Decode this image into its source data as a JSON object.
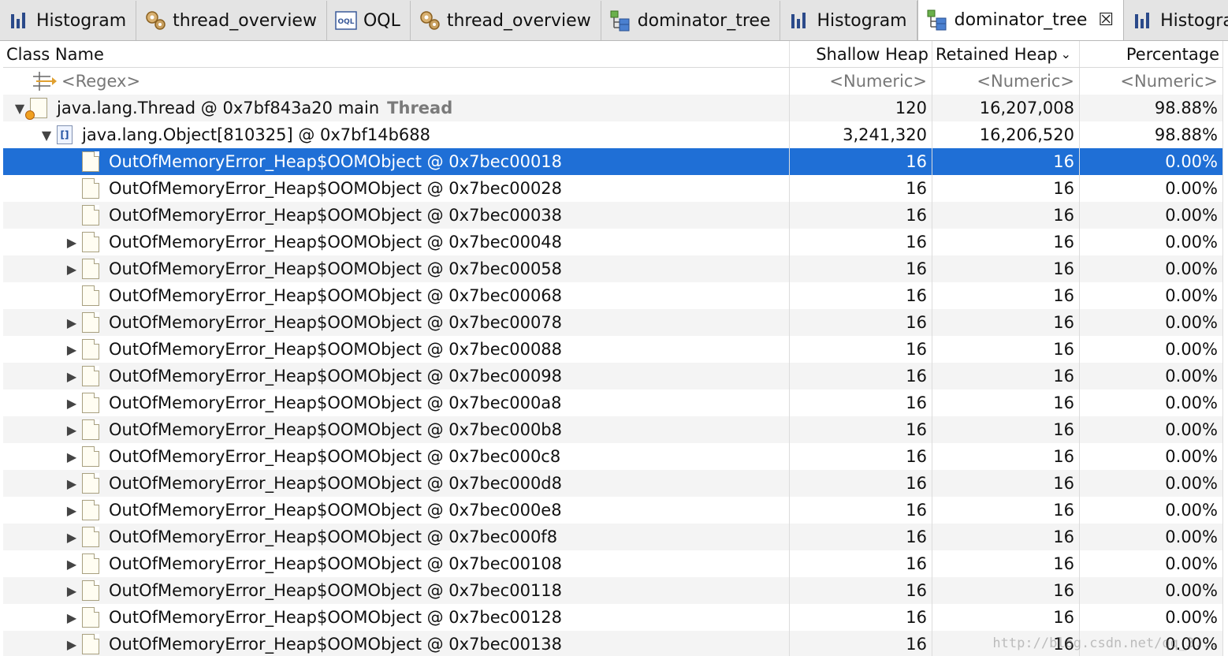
{
  "tabs": [
    {
      "label": "Histogram",
      "icon": "histogram-icon",
      "active": false
    },
    {
      "label": "thread_overview",
      "icon": "gears-icon",
      "active": false
    },
    {
      "label": "OQL",
      "icon": "oql-icon",
      "active": false
    },
    {
      "label": "thread_overview",
      "icon": "gears-icon",
      "active": false
    },
    {
      "label": "dominator_tree",
      "icon": "dominator-tree-icon",
      "active": false
    },
    {
      "label": "Histogram",
      "icon": "histogram-icon",
      "active": false
    },
    {
      "label": "dominator_tree",
      "icon": "dominator-tree-icon",
      "active": true
    },
    {
      "label": "Histogram",
      "icon": "histogram-icon",
      "active": false
    }
  ],
  "tab_overflow": "»",
  "table": {
    "headers": {
      "class_name": "Class Name",
      "shallow_heap": "Shallow Heap",
      "retained_heap": "Retained Heap",
      "percentage": "Percentage"
    },
    "sort_indicator": "⌄",
    "filter_row": {
      "name": "<Regex>",
      "shallow": "<Numeric>",
      "retained": "<Numeric>",
      "percentage": "<Numeric>"
    },
    "thread_row": {
      "name": "java.lang.Thread @ 0x7bf843a20  main",
      "thread_label": "Thread",
      "shallow": "120",
      "retained": "16,207,008",
      "percentage": "98.88%"
    },
    "array_row": {
      "name": "java.lang.Object[810325] @ 0x7bf14b688",
      "shallow": "3,241,320",
      "retained": "16,206,520",
      "percentage": "98.88%"
    },
    "object_rows": [
      {
        "name": "OutOfMemoryError_Heap$OOMObject @ 0x7bec00018",
        "shallow": "16",
        "retained": "16",
        "percentage": "0.00%",
        "expandable": false,
        "selected": true
      },
      {
        "name": "OutOfMemoryError_Heap$OOMObject @ 0x7bec00028",
        "shallow": "16",
        "retained": "16",
        "percentage": "0.00%",
        "expandable": false,
        "selected": false
      },
      {
        "name": "OutOfMemoryError_Heap$OOMObject @ 0x7bec00038",
        "shallow": "16",
        "retained": "16",
        "percentage": "0.00%",
        "expandable": false,
        "selected": false
      },
      {
        "name": "OutOfMemoryError_Heap$OOMObject @ 0x7bec00048",
        "shallow": "16",
        "retained": "16",
        "percentage": "0.00%",
        "expandable": true,
        "selected": false
      },
      {
        "name": "OutOfMemoryError_Heap$OOMObject @ 0x7bec00058",
        "shallow": "16",
        "retained": "16",
        "percentage": "0.00%",
        "expandable": true,
        "selected": false
      },
      {
        "name": "OutOfMemoryError_Heap$OOMObject @ 0x7bec00068",
        "shallow": "16",
        "retained": "16",
        "percentage": "0.00%",
        "expandable": false,
        "selected": false
      },
      {
        "name": "OutOfMemoryError_Heap$OOMObject @ 0x7bec00078",
        "shallow": "16",
        "retained": "16",
        "percentage": "0.00%",
        "expandable": true,
        "selected": false
      },
      {
        "name": "OutOfMemoryError_Heap$OOMObject @ 0x7bec00088",
        "shallow": "16",
        "retained": "16",
        "percentage": "0.00%",
        "expandable": true,
        "selected": false
      },
      {
        "name": "OutOfMemoryError_Heap$OOMObject @ 0x7bec00098",
        "shallow": "16",
        "retained": "16",
        "percentage": "0.00%",
        "expandable": true,
        "selected": false
      },
      {
        "name": "OutOfMemoryError_Heap$OOMObject @ 0x7bec000a8",
        "shallow": "16",
        "retained": "16",
        "percentage": "0.00%",
        "expandable": true,
        "selected": false
      },
      {
        "name": "OutOfMemoryError_Heap$OOMObject @ 0x7bec000b8",
        "shallow": "16",
        "retained": "16",
        "percentage": "0.00%",
        "expandable": true,
        "selected": false
      },
      {
        "name": "OutOfMemoryError_Heap$OOMObject @ 0x7bec000c8",
        "shallow": "16",
        "retained": "16",
        "percentage": "0.00%",
        "expandable": true,
        "selected": false
      },
      {
        "name": "OutOfMemoryError_Heap$OOMObject @ 0x7bec000d8",
        "shallow": "16",
        "retained": "16",
        "percentage": "0.00%",
        "expandable": true,
        "selected": false
      },
      {
        "name": "OutOfMemoryError_Heap$OOMObject @ 0x7bec000e8",
        "shallow": "16",
        "retained": "16",
        "percentage": "0.00%",
        "expandable": true,
        "selected": false
      },
      {
        "name": "OutOfMemoryError_Heap$OOMObject @ 0x7bec000f8",
        "shallow": "16",
        "retained": "16",
        "percentage": "0.00%",
        "expandable": true,
        "selected": false
      },
      {
        "name": "OutOfMemoryError_Heap$OOMObject @ 0x7bec00108",
        "shallow": "16",
        "retained": "16",
        "percentage": "0.00%",
        "expandable": true,
        "selected": false
      },
      {
        "name": "OutOfMemoryError_Heap$OOMObject @ 0x7bec00118",
        "shallow": "16",
        "retained": "16",
        "percentage": "0.00%",
        "expandable": true,
        "selected": false
      },
      {
        "name": "OutOfMemoryError_Heap$OOMObject @ 0x7bec00128",
        "shallow": "16",
        "retained": "16",
        "percentage": "0.00%",
        "expandable": true,
        "selected": false
      },
      {
        "name": "OutOfMemoryError_Heap$OOMObject @ 0x7bec00138",
        "shallow": "16",
        "retained": "16",
        "percentage": "0.00%",
        "expandable": true,
        "selected": false
      }
    ]
  },
  "watermark": "http://blog.csdn.net/qq_3...",
  "colors": {
    "selection": "#1f6fd6",
    "tabbar": "#e4e4e4",
    "thread_label": "#7a7a7a"
  }
}
